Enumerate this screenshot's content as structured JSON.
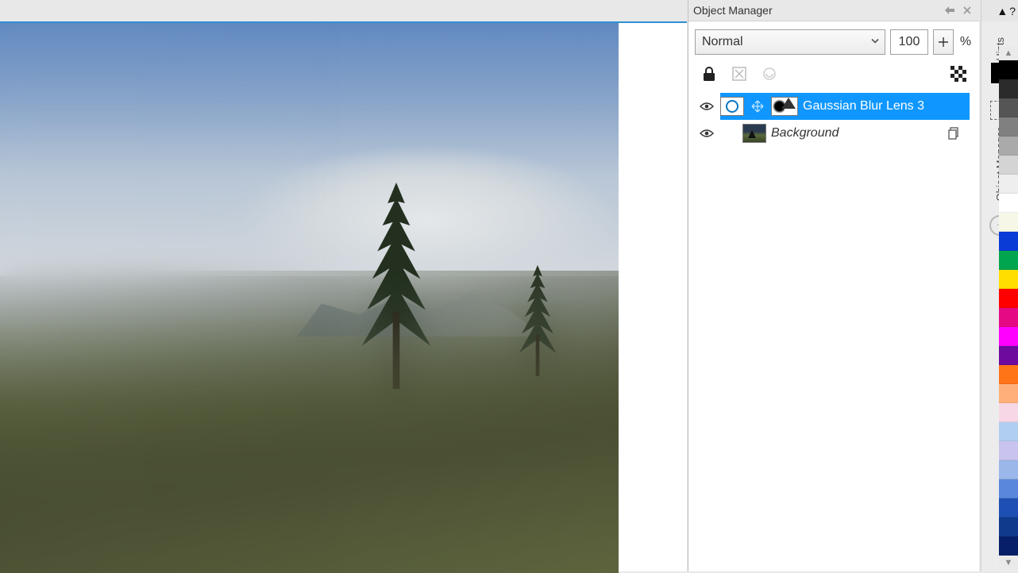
{
  "panel": {
    "title": "Object Manager",
    "merge_mode": "Normal",
    "opacity_value": "100",
    "opacity_unit": "%"
  },
  "layers": [
    {
      "name": "Gaussian Blur Lens 3",
      "type": "lens",
      "selected": true
    },
    {
      "name": "Background",
      "type": "background",
      "selected": false
    }
  ],
  "dockers": {
    "hints_label": "Hints",
    "objmgr_label": "Object Manager"
  },
  "palette_colors": [
    "#000000",
    "#2b2b2b",
    "#555555",
    "#808080",
    "#aaaaaa",
    "#d4d4d4",
    "#eeeeee",
    "#ffffff",
    "#f7f7e8",
    "#0a3bd6",
    "#00a64f",
    "#ffde00",
    "#ff0000",
    "#e50a84",
    "#ff00ff",
    "#6e0a9e",
    "#ff7417",
    "#ffb07a",
    "#f7d6e6",
    "#b0cff0",
    "#c9c3ef",
    "#9bb6e8",
    "#5a87db",
    "#1e4fb3",
    "#103a8c",
    "#061f66"
  ]
}
